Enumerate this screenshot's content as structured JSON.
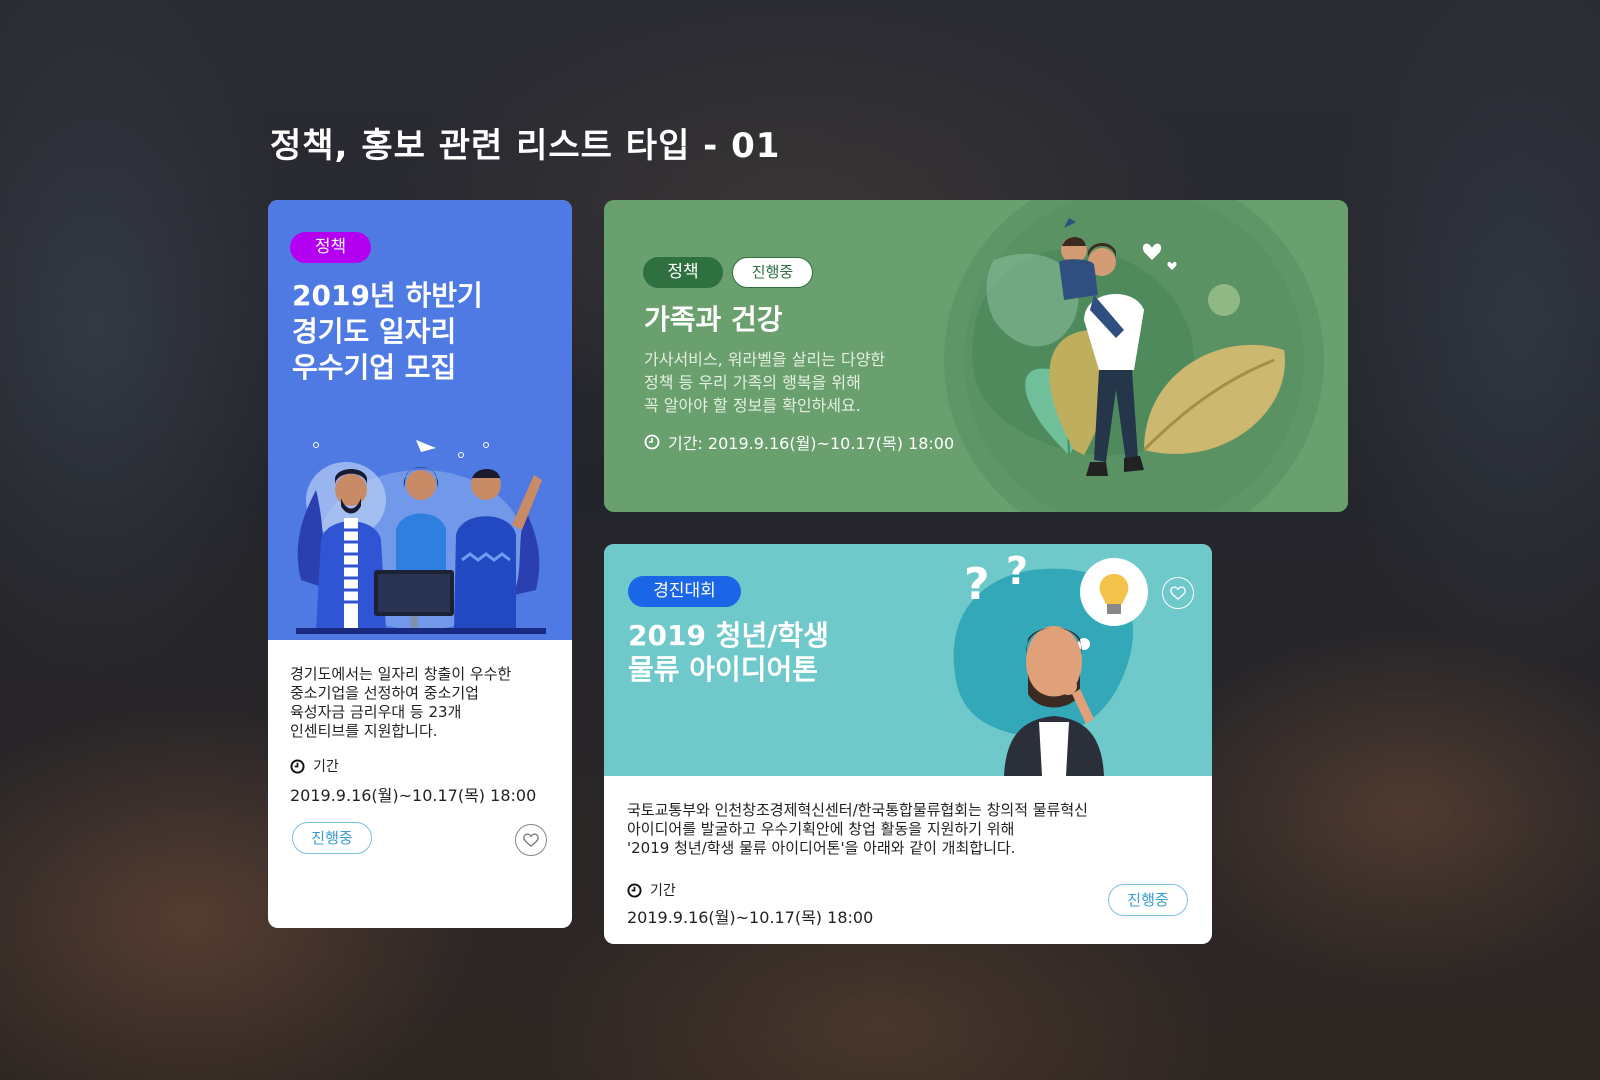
{
  "page": {
    "title": "정책, 홍보 관련 리스트 타입 - 01"
  },
  "cards": [
    {
      "tag": "정책",
      "title_lines": [
        "2019년 하반기",
        "경기도 일자리",
        "우수기업 모집"
      ],
      "description_lines": [
        "경기도에서는 일자리 창출이 우수한",
        "중소기업을 선정하여 중소기업",
        "육성자금 금리우대 등 23개",
        "인센티브를 지원합니다."
      ],
      "period_label": "기간",
      "period": "2019.9.16(월)~10.17(목) 18:00",
      "status": "진행중",
      "colors": {
        "header": "#4f7ae3",
        "tag": "#b400f0"
      }
    },
    {
      "tags": [
        "정책",
        "진행중"
      ],
      "title": "가족과 건강",
      "description_lines": [
        "가사서비스, 워라벨을 살리는 다양한",
        "정책 등 우리 가족의 행복을 위해",
        "꼭 알아야 할 정보를 확인하세요."
      ],
      "period": "기간: 2019.9.16(월)~10.17(목) 18:00",
      "colors": {
        "background": "#6aa06d",
        "tag": "#2f7040"
      }
    },
    {
      "tag": "경진대회",
      "title_lines": [
        "2019 청년/학생",
        "물류 아이디어톤"
      ],
      "description_lines": [
        "국토교통부와 인천창조경제혁신센터/한국통합물류협회는 창의적 물류혁신",
        "아이디어를 발굴하고 우수기획안에 창업 활동을 지원하기 위해",
        "'2019 청년/학생 물류 아이디어톤'을 아래와 같이 개최합니다."
      ],
      "period_label": "기간",
      "period": "2019.9.16(월)~10.17(목) 18:00",
      "status": "진행중",
      "colors": {
        "header": "#6fc9cb",
        "tag": "#1a66e6"
      }
    }
  ],
  "icons": [
    "clock-icon",
    "heart-icon"
  ]
}
